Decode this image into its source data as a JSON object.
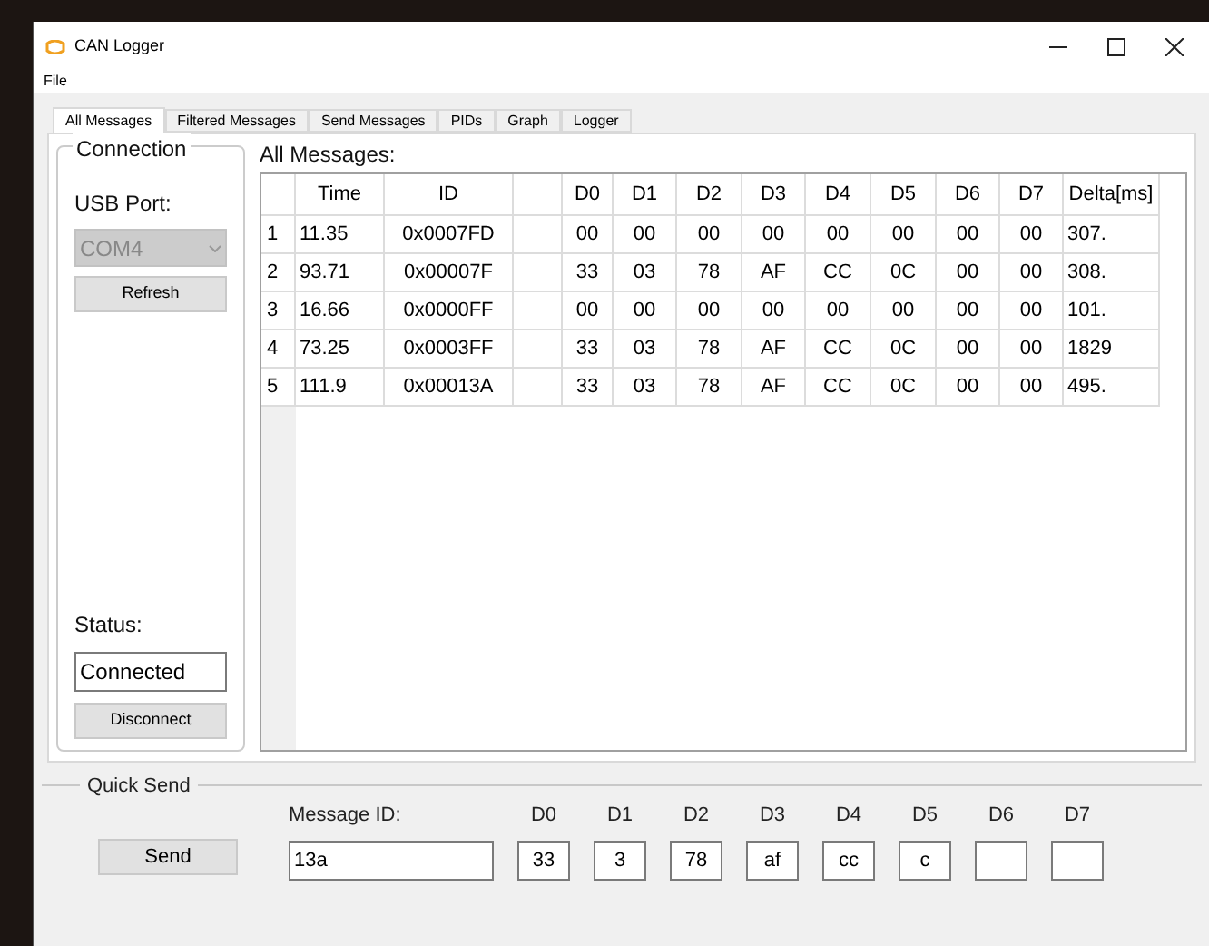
{
  "window": {
    "title": "CAN Logger"
  },
  "menu": [
    "File"
  ],
  "tabs": [
    {
      "label": "All Messages",
      "selected": true
    },
    {
      "label": "Filtered Messages",
      "selected": false
    },
    {
      "label": "Send Messages",
      "selected": false
    },
    {
      "label": "PIDs",
      "selected": false
    },
    {
      "label": "Graph",
      "selected": false
    },
    {
      "label": "Logger",
      "selected": false
    }
  ],
  "connection": {
    "title": "Connection",
    "port_label": "USB Port:",
    "port": {
      "value": "COM4",
      "disabled": true
    },
    "refresh_button": "Refresh",
    "status_label": "Status:",
    "status": "Connected",
    "disconnect_button": "Disconnect"
  },
  "messages": {
    "title": "All Messages:",
    "columns": [
      "Time",
      "ID",
      "",
      "D0",
      "D1",
      "D2",
      "D3",
      "D4",
      "D5",
      "D6",
      "D7",
      "Delta[ms]"
    ],
    "rows": [
      {
        "index": "1",
        "cells": [
          "11.35",
          "0x0007FD",
          "",
          "00",
          "00",
          "00",
          "00",
          "00",
          "00",
          "00",
          "00",
          "307."
        ]
      },
      {
        "index": "2",
        "cells": [
          "93.71",
          "0x00007F",
          "",
          "33",
          "03",
          "78",
          "AF",
          "CC",
          "0C",
          "00",
          "00",
          "308."
        ]
      },
      {
        "index": "3",
        "cells": [
          "16.66",
          "0x0000FF",
          "",
          "00",
          "00",
          "00",
          "00",
          "00",
          "00",
          "00",
          "00",
          "101."
        ]
      },
      {
        "index": "4",
        "cells": [
          "73.25",
          "0x0003FF",
          "",
          "33",
          "03",
          "78",
          "AF",
          "CC",
          "0C",
          "00",
          "00",
          "1829"
        ]
      },
      {
        "index": "5",
        "cells": [
          "111.9",
          "0x00013A",
          "",
          "33",
          "03",
          "78",
          "AF",
          "CC",
          "0C",
          "00",
          "00",
          "495."
        ]
      }
    ]
  },
  "quick_send": {
    "title": "Quick Send",
    "send_button": "Send",
    "id_label": "Message ID:",
    "id_value": "13a",
    "bytes": [
      {
        "label": "D0",
        "value": "33"
      },
      {
        "label": "D1",
        "value": "3"
      },
      {
        "label": "D2",
        "value": "78"
      },
      {
        "label": "D3",
        "value": "af"
      },
      {
        "label": "D4",
        "value": "cc"
      },
      {
        "label": "D5",
        "value": "c"
      },
      {
        "label": "D6"
      },
      {
        "label": "D7"
      }
    ]
  }
}
